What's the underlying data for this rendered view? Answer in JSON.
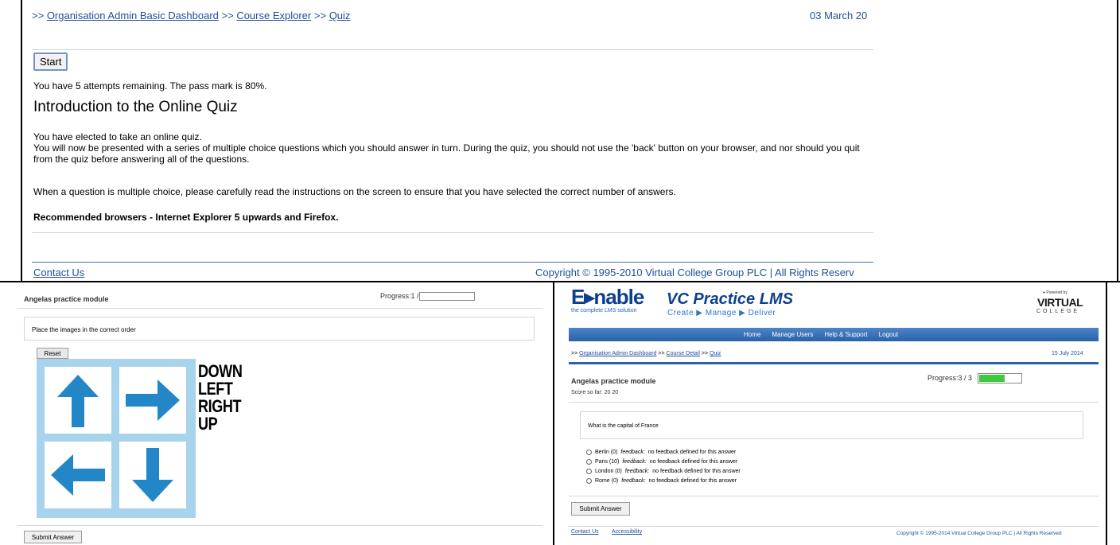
{
  "top": {
    "breadcrumb": {
      "sep": ">>",
      "items": [
        "Organisation Admin Basic Dashboard",
        "Course Explorer",
        "Quiz"
      ]
    },
    "date": "03 March 20",
    "start_label": "Start",
    "attempts_text": "You have 5 attempts remaining. The pass mark is 80%.",
    "title": "Introduction to the Online Quiz",
    "intro_line1": "You have elected to take an online quiz.",
    "intro_line2": "You will now be presented with a series of multiple choice questions which you should answer in turn. During the quiz, you should not use the 'back' button on your browser, and nor should you quit from the quiz before answering all of the questions.",
    "intro_p2": "When a question is multiple choice, please carefully read the instructions on the screen to ensure that you have selected the correct number of answers.",
    "recommended": "Recommended browsers - Internet Explorer 5 upwards and Firefox.",
    "contact": "Contact Us",
    "copyright": "Copyright © 1995-2010 Virtual College Group PLC | All Rights Reserv"
  },
  "left": {
    "module_title": "Angelas practice module",
    "progress_label": "Progress:1 / 3",
    "progress_fraction": 0,
    "question": "Place the images in the correct order",
    "reset_label": "Reset",
    "arrow_tiles": [
      "arrow-up",
      "arrow-right",
      "arrow-left",
      "arrow-down"
    ],
    "accent_color": "#2387c7",
    "words": [
      "DOWN",
      "LEFT",
      "RIGHT",
      "UP"
    ],
    "submit_label": "Submit Answer"
  },
  "right": {
    "brand": "E▸nable",
    "brand_tag": "the complete LMS solution",
    "lms_title": "VC Practice LMS",
    "tagline": "Create ▶ Manage ▶ Deliver",
    "powered_by": "● Powered by",
    "vc_brand": "VIRTUAL",
    "vc_sub": "COLLEGE",
    "nav": [
      "Home",
      "Manage Users",
      "Help & Support",
      "Logout"
    ],
    "breadcrumb": {
      "sep": ">>",
      "items": [
        "Organisation Admin Dashboard",
        "Course Detail",
        "Quiz"
      ]
    },
    "date": "15 July 2014",
    "module_title": "Angelas practice module",
    "progress_label": "Progress:3 / 3",
    "progress_fraction": 0.62,
    "progress_color": "#3ec93e",
    "score": "Score so far: 20 20",
    "question": "What is the capital of France",
    "answers": [
      {
        "text": "Berlin (0)",
        "fb_label": "feedback:",
        "fb": "no feedback defined for this answer"
      },
      {
        "text": "Paris (10)",
        "fb_label": "feedback:",
        "fb": "no feedback defined for this answer"
      },
      {
        "text": "London (0)",
        "fb_label": "feedback:",
        "fb": "no feedback defined for this answer"
      },
      {
        "text": "Rome (0)",
        "fb_label": "feedback:",
        "fb": "no feedback defined for this answer"
      }
    ],
    "submit_label": "Submit Answer",
    "contact": "Contact Us",
    "accessibility": "Accessibility",
    "copyright": "Copyright © 1995-2014 Virtual College Group PLC | All Rights Reserved"
  }
}
